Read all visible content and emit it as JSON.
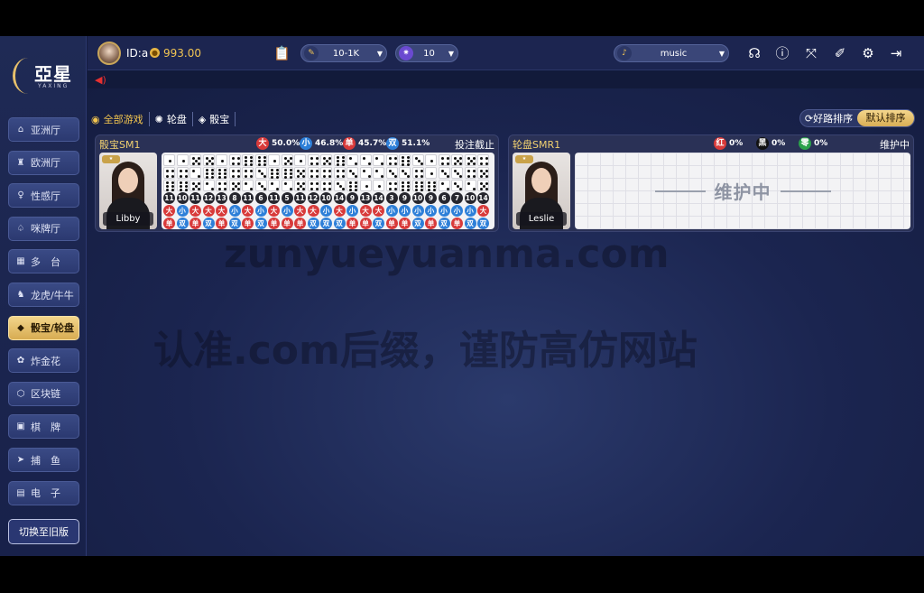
{
  "brand": {
    "name": "亞星",
    "sub": "YAXING"
  },
  "sidebar": {
    "items": [
      {
        "label": "亚洲厅",
        "icon": "⌂",
        "icon_name": "home-icon",
        "active": false
      },
      {
        "label": "欧洲厅",
        "icon": "♜",
        "icon_name": "tower-icon",
        "active": false
      },
      {
        "label": "性感厅",
        "icon": "♀",
        "icon_name": "lady-icon",
        "active": false
      },
      {
        "label": "咪牌厅",
        "icon": "♤",
        "icon_name": "card-icon",
        "active": false
      },
      {
        "label": "多　台",
        "icon": "▦",
        "icon_name": "multi-table-icon",
        "active": false
      },
      {
        "label": "龙虎/牛牛",
        "icon": "♞",
        "icon_name": "dragon-icon",
        "active": false
      },
      {
        "label": "骰宝/轮盘",
        "icon": "◆",
        "icon_name": "dice-icon",
        "active": true
      },
      {
        "label": "炸金花",
        "icon": "✿",
        "icon_name": "flower-icon",
        "active": false
      },
      {
        "label": "区块链",
        "icon": "⬡",
        "icon_name": "blockchain-icon",
        "active": false
      },
      {
        "label": "棋　牌",
        "icon": "▣",
        "icon_name": "chess-card-icon",
        "active": false
      },
      {
        "label": "捕　鱼",
        "icon": "➤",
        "icon_name": "fish-icon",
        "active": false
      },
      {
        "label": "电　子",
        "icon": "▤",
        "icon_name": "slot-icon",
        "active": false
      }
    ],
    "switch_label": "切换至旧版"
  },
  "topbar": {
    "user_id": "ID:a",
    "balance": "993.00",
    "limit": "10-1K",
    "chip": "10",
    "music": "music"
  },
  "filters": [
    {
      "label": "全部游戏",
      "icon": "◉",
      "icon_name": "globe-icon",
      "active": true
    },
    {
      "label": "轮盘",
      "icon": "✺",
      "icon_name": "roulette-icon",
      "active": false
    },
    {
      "label": "骰宝",
      "icon": "◈",
      "icon_name": "dice-icon",
      "active": false
    }
  ],
  "sort": {
    "good_road": "好路排序",
    "default": "默认排序"
  },
  "tables": [
    {
      "name": "骰宝SM1",
      "status": "投注截止",
      "dealer": "Libby",
      "stats": [
        {
          "badge": "大",
          "value": "50.0%",
          "color": "#d83a3a"
        },
        {
          "badge": "小",
          "value": "46.8%",
          "color": "#2d7fd8"
        },
        {
          "badge": "单",
          "value": "45.7%",
          "color": "#d83a3a"
        },
        {
          "badge": "双",
          "value": "51.1%",
          "color": "#2d7fd8"
        }
      ],
      "dice": [
        [
          1,
          1,
          5,
          5,
          1,
          4,
          6,
          6,
          1,
          5,
          1,
          4,
          5,
          6,
          2,
          2,
          2,
          4,
          6,
          3,
          1,
          4,
          5,
          5,
          4
        ],
        [
          4,
          4,
          2,
          6,
          6,
          4,
          4,
          3,
          6,
          6,
          5,
          4,
          4,
          4,
          3,
          2,
          2,
          3,
          3,
          4,
          1,
          3,
          3,
          4,
          5
        ],
        [
          6,
          6,
          5,
          2,
          4,
          5,
          2,
          3,
          2,
          2,
          5,
          4,
          4,
          3,
          6,
          1,
          1,
          4,
          6,
          6,
          6,
          2,
          3,
          2,
          5
        ]
      ],
      "totals": [
        "11",
        "10",
        "11",
        "12",
        "13",
        "8",
        "11",
        "6",
        "11",
        "5",
        "11",
        "12",
        "10",
        "14",
        "9",
        "13",
        "14",
        "3",
        "9",
        "10",
        "9",
        "6",
        "7",
        "10",
        "14"
      ],
      "size": [
        "大",
        "小",
        "大",
        "大",
        "大",
        "小",
        "大",
        "小",
        "大",
        "小",
        "大",
        "大",
        "小",
        "大",
        "小",
        "大",
        "大",
        "小",
        "小",
        "小",
        "小",
        "小",
        "小",
        "小",
        "大"
      ],
      "parity": [
        "单",
        "双",
        "单",
        "双",
        "单",
        "双",
        "单",
        "双",
        "单",
        "单",
        "单",
        "双",
        "双",
        "双",
        "单",
        "单",
        "双",
        "单",
        "单",
        "双",
        "单",
        "双",
        "单",
        "双",
        "双"
      ]
    },
    {
      "name": "轮盘SMR1",
      "status": "维护中",
      "dealer": "Leslie",
      "stats": [
        {
          "badge": "红",
          "value": "0%",
          "color": "#d83a3a"
        },
        {
          "badge": "黑",
          "value": "0%",
          "color": "#111111"
        },
        {
          "badge": "零",
          "value": "0%",
          "color": "#2aa14a"
        }
      ],
      "maintenance_text": "维护中"
    }
  ],
  "watermarks": {
    "line1": "zunyueyuanma.com",
    "line2": "认准.com后缀，谨防高仿网站"
  },
  "colors": {
    "gold": "#f0c453",
    "red": "#d83a3a",
    "blue": "#2d7fd8"
  }
}
